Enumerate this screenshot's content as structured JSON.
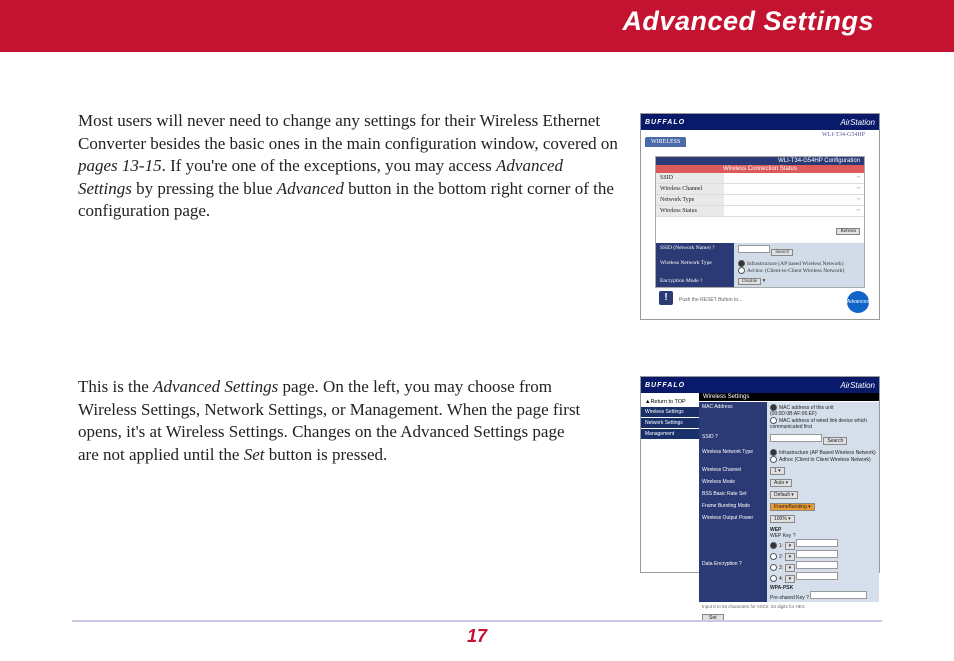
{
  "header": {
    "title": "Advanced Settings"
  },
  "para1": {
    "t1": "Most users will never need to change any settings for their Wireless Ethernet Converter besides the basic ones in the main configuration window, covered on ",
    "i1": "pages 13-15",
    "t2": ".  If you're one of the exceptions, you may access ",
    "i2": "Advanced Settings",
    "t3": " by pressing the blue ",
    "i3": "Advanced",
    "t4": " button in the bottom right corner of the configuration page."
  },
  "para2": {
    "t1": "This is the ",
    "i1": "Advanced Settings",
    "t2": " page.  On the left, you may choose from Wireless Settings, Network Settings, or Management.  When the page first opens, it's at Wireless Settings.  Changes on the Advanced Settings page are not applied until the ",
    "i2": "Set",
    "t3": " button is pressed."
  },
  "thumb1": {
    "brand": "BUFFALO",
    "air": "AirStation",
    "tab": "WIRELESS",
    "panelTitle": "WLI-T34-G54HP",
    "cfgTitle": "WLI-T34-G54HP Configuration",
    "statusBar": "Wireless Connection Status",
    "ssid_l": "SSID",
    "ssid_v": "~",
    "ch_l": "Wireless Channel",
    "net_l": "Network Type",
    "ws_l": "Wireless Status",
    "stat_btn": "Refresh",
    "kSSID": "SSID (Network Name)  ?",
    "vSSID_btn": "Search",
    "kType": "Wireless Network Type",
    "infra": "Infrastructure (AP based Wireless Network)",
    "adhoc": "Ad-hoc (Client-to-Client Wireless Network)",
    "kEnc": "Encryption Mode  ?",
    "vEnc": "Disable",
    "foot": "Push the RESET Button to...",
    "blueBtn": "Advanced"
  },
  "thumb2": {
    "brand": "BUFFALO",
    "air": "AirStation",
    "return": "▲Return to TOP",
    "s1": "Wireless Settings",
    "s2": "Network Settings",
    "s3": "Management",
    "title": "Wireless Settings",
    "mac_l": "MAC Address",
    "mac_o1": "MAC address of this unit (00:0D:0B:AF:06:EF)",
    "mac_o2": "MAC address of wired link device which communicated first",
    "ssid_l": "SSID  ?",
    "nt_l": "Wireless Network Type",
    "nt_o1": "Infrastructure (AP Based Wireless Network)",
    "nt_o2": "Adhoc (Client to Client Wireless Network)",
    "wc_l": "Wireless Channel",
    "wm_l": "Wireless Mode",
    "bss_l": "BSS Basic Rate Set",
    "fb_l": "Frame Bursting Mode",
    "op_l": "Wireless Output Power",
    "de_l": "Data Encryption  ?",
    "wep": "WEP",
    "wepkey": "WEP Key  ?",
    "k1": "1:",
    "k2": "2:",
    "k3": "3:",
    "k4": "4:",
    "wpa": "WPA-PSK",
    "psk": "Pre-shared Key  ?",
    "note": "Input 8 to 63 characters for ASCII, 64 digits for HEX",
    "setBtn": "Set",
    "search": "Search"
  },
  "pageNumber": "17"
}
